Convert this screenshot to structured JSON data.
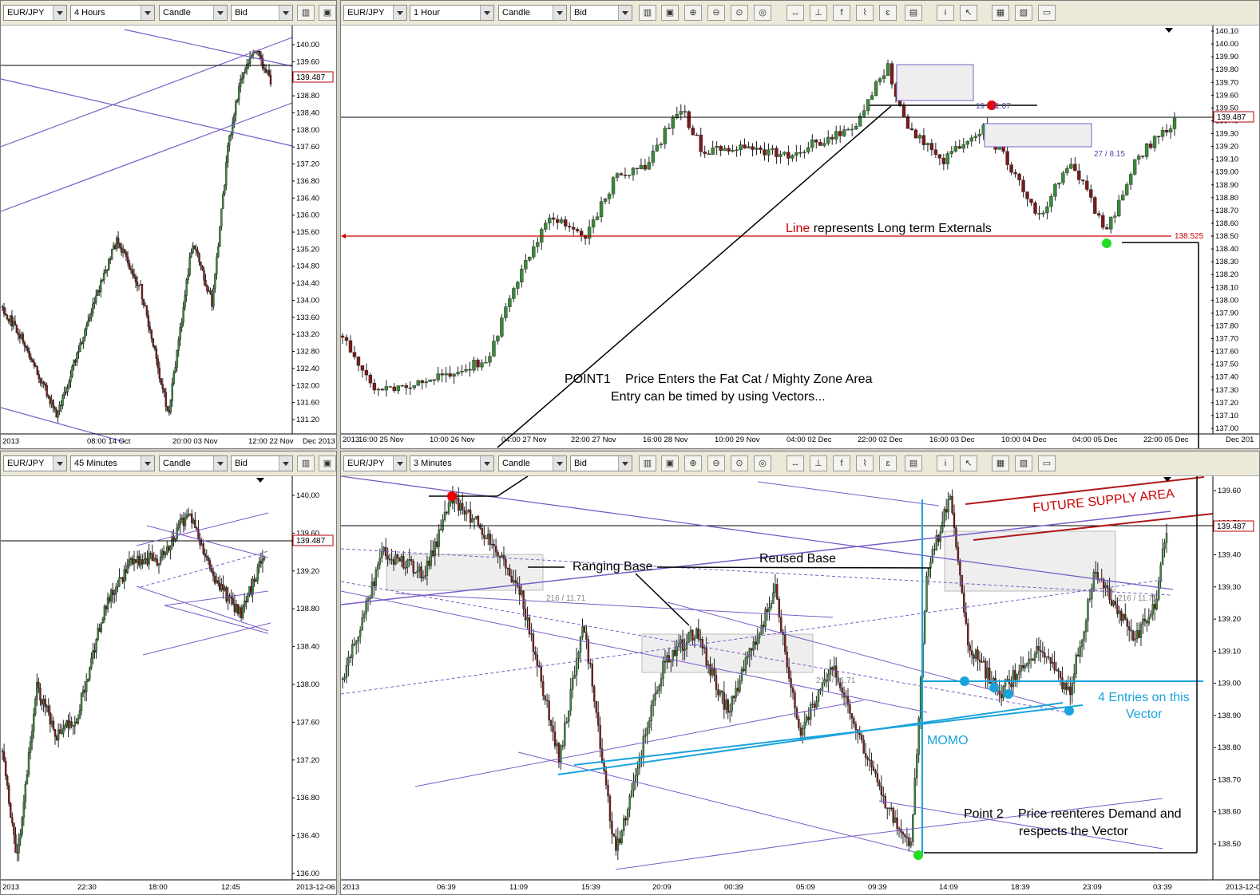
{
  "colors": {
    "bull": "#3a8a3a",
    "bear": "#7a1a1a",
    "purple": "#7a5cc8",
    "cyan": "#1aa3dc",
    "red": "#cc0000",
    "zone": "#eeeeee"
  },
  "icons": [
    "chart-icon",
    "lock-icon",
    "zoom-in-icon",
    "zoom-out-icon",
    "fit-icon",
    "expand-icon",
    "period-icon",
    "function-icon",
    "draw-icon",
    "sheet-icon",
    "info-icon",
    "cursor-icon",
    "grid-icon",
    "save-icon",
    "layout-icon"
  ],
  "panels": {
    "p1": {
      "symbol": "EUR/JPY",
      "timeframe": "4 Hours",
      "type": "Candle",
      "side": "Bid",
      "price": "139.487",
      "yticks": [
        "140.00",
        "139.60",
        "139.20",
        "138.80",
        "138.40",
        "138.00",
        "137.60",
        "137.20",
        "136.80",
        "136.40",
        "136.00",
        "135.60",
        "135.20",
        "134.80",
        "134.40",
        "134.00",
        "133.60",
        "133.20",
        "132.80",
        "132.40",
        "132.00",
        "131.60",
        "131.20"
      ],
      "xticks": [
        "2013",
        "08:00 14 Oct",
        "20:00 03 Nov",
        "12:00 22 Nov",
        "Dec 2013"
      ]
    },
    "p2": {
      "symbol": "EUR/JPY",
      "timeframe": "1 Hour",
      "type": "Candle",
      "side": "Bid",
      "price": "139.487",
      "level": "138.525",
      "yticks": [
        "140.10",
        "140.00",
        "139.90",
        "139.80",
        "139.70",
        "139.60",
        "139.50",
        "139.40",
        "139.30",
        "139.20",
        "139.10",
        "139.00",
        "138.90",
        "138.80",
        "138.70",
        "138.60",
        "138.50",
        "138.40",
        "138.30",
        "138.20",
        "138.10",
        "138.00",
        "137.90",
        "137.80",
        "137.70",
        "137.60",
        "137.50",
        "137.40",
        "137.30",
        "137.20",
        "137.10",
        "137.00"
      ],
      "xticks": [
        "2013",
        "16:00 25 Nov",
        "10:00 26 Nov",
        "04:00 27 Nov",
        "22:00 27 Nov",
        "16:00 28 Nov",
        "10:00 29 Nov",
        "04:00 02 Dec",
        "22:00 02 Dec",
        "16:00 03 Dec",
        "10:00 04 Dec",
        "04:00 05 Dec",
        "22:00 05 Dec",
        "Dec 201"
      ],
      "labels": {
        "fib1": "19 / 11.07",
        "fib2": "27 / 8.15"
      },
      "annotation_line_red": "Line",
      "annotation_line_rest": " represents Long term Externals",
      "point1_a": "POINT1",
      "point1_b": "Price Enters the Fat Cat / Mighty Zone Area",
      "point1_c": "Entry can be timed by using Vectors..."
    },
    "p3": {
      "symbol": "EUR/JPY",
      "timeframe": "45 Minutes",
      "type": "Candle",
      "side": "Bid",
      "price": "139.487",
      "yticks": [
        "140.00",
        "139.60",
        "139.20",
        "138.80",
        "138.40",
        "138.00",
        "137.60",
        "137.20",
        "136.80",
        "136.40",
        "136.00"
      ],
      "xticks": [
        "2013",
        "22:30",
        "18:00",
        "12:45",
        "2013-12-06"
      ]
    },
    "p4": {
      "symbol": "EUR/JPY",
      "timeframe": "3 Minutes",
      "type": "Candle",
      "side": "Bid",
      "price": "139.487",
      "yticks": [
        "139.60",
        "139.50",
        "139.40",
        "139.30",
        "139.20",
        "139.10",
        "139.00",
        "138.90",
        "138.80",
        "138.70",
        "138.60",
        "138.50"
      ],
      "xticks": [
        "2013",
        "06:39",
        "11:09",
        "15:39",
        "20:09",
        "00:39",
        "05:09",
        "09:39",
        "14:09",
        "18:39",
        "23:09",
        "03:39",
        "2013-12-06"
      ],
      "labels": {
        "fib1": "216 / 11.71",
        "fib2": "216 / 11.71",
        "fib3": "216 / 11.71"
      },
      "ranging_base": "Ranging Base",
      "reused_base": "Reused Base",
      "future_supply": "FUTURE SUPPLY AREA",
      "entries_a": "4 Entries on this",
      "entries_b": "Vector",
      "momo": "MOMO",
      "point2_a": "Point 2",
      "point2_b": "Price reenteres Demand and",
      "point2_c": "respects the Vector"
    }
  },
  "chart_data": [
    {
      "type": "candlestick",
      "timeframe": "4 Hours",
      "ylim": [
        131.0,
        140.2
      ],
      "last": 139.487
    },
    {
      "type": "candlestick",
      "timeframe": "1 Hour",
      "ylim": [
        136.95,
        140.15
      ],
      "last": 139.487,
      "horizontal_level": 138.525
    },
    {
      "type": "candlestick",
      "timeframe": "45 Minutes",
      "ylim": [
        135.9,
        140.3
      ],
      "last": 139.487
    },
    {
      "type": "candlestick",
      "timeframe": "3 Minutes",
      "ylim": [
        138.43,
        139.63
      ],
      "last": 139.487
    }
  ]
}
